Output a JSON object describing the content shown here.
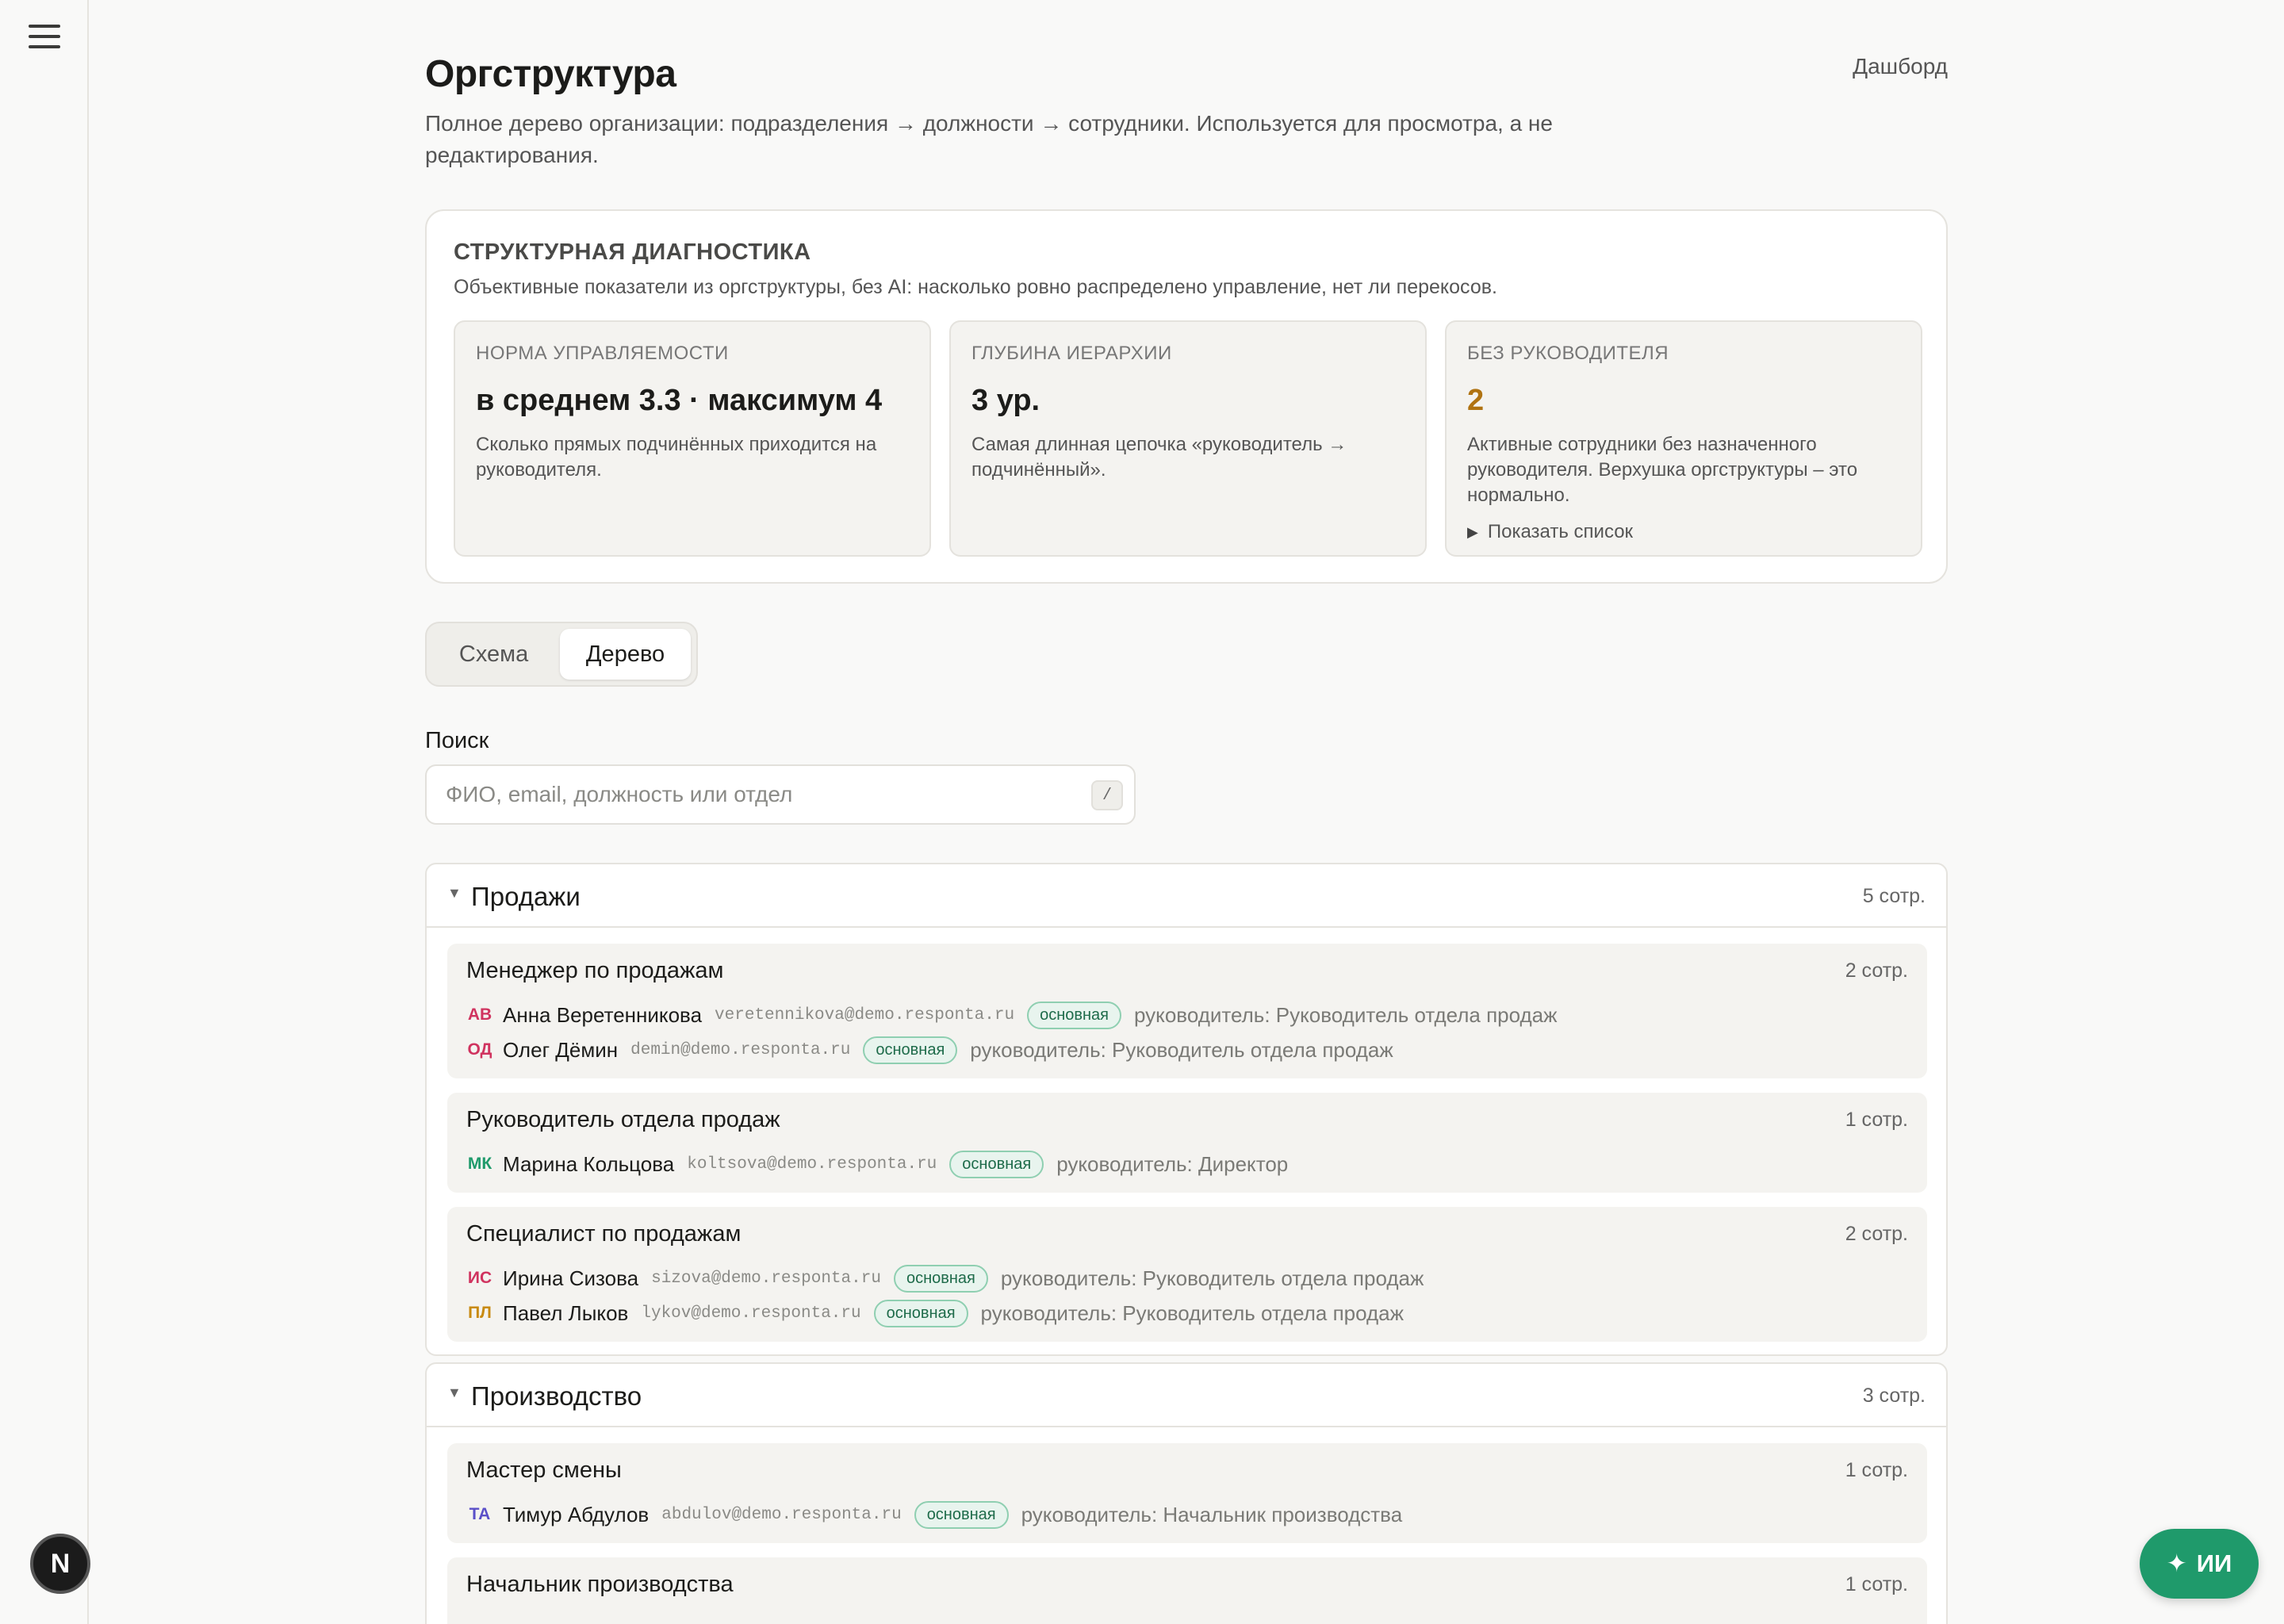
{
  "page": {
    "title": "Оргструктура",
    "dashboard_link": "Дашборд",
    "description": "Полное дерево организации: подразделения → должности → сотрудники. Используется для просмотра, а не редактирования."
  },
  "diagnostics": {
    "title": "СТРУКТУРНАЯ ДИАГНОСТИКА",
    "subtitle": "Объективные показатели из оргструктуры, без AI: насколько ровно распределено управление, нет ли перекосов.",
    "metrics": [
      {
        "label": "НОРМА УПРАВЛЯЕМОСТИ",
        "value": "в среднем 3.3 · максимум 4",
        "desc": "Сколько прямых подчинённых приходится на руководителя."
      },
      {
        "label": "ГЛУБИНА ИЕРАРХИИ",
        "value": "3 ур.",
        "desc": "Самая длинная цепочка «руководитель → подчинённый»."
      },
      {
        "label": "БЕЗ РУКОВОДИТЕЛЯ",
        "value": "2",
        "desc": "Активные сотрудники без назначенного руководителя. Верхушка оргструктуры – это нормально.",
        "toggle": "Показать список"
      }
    ],
    "warn_color": "#b07312"
  },
  "view_toggle": {
    "schema": "Схема",
    "tree": "Дерево",
    "active": "tree"
  },
  "search": {
    "label": "Поиск",
    "placeholder": "ФИО, email, должность или отдел",
    "value": "",
    "shortcut": "/"
  },
  "departments": [
    {
      "name": "Продажи",
      "count": "5 сотр.",
      "positions": [
        {
          "title": "Менеджер по продажам",
          "count": "2 сотр.",
          "employees": [
            {
              "initials": "АВ",
              "color": "#d0335f",
              "name": "Анна Веретенникова",
              "email": "veretennikova@demo.responta.ru",
              "badge": "основная",
              "manager": "руководитель: Руководитель отдела продаж"
            },
            {
              "initials": "ОД",
              "color": "#d0335f",
              "name": "Олег Дёмин",
              "email": "demin@demo.responta.ru",
              "badge": "основная",
              "manager": "руководитель: Руководитель отдела продаж"
            }
          ]
        },
        {
          "title": "Руководитель отдела продаж",
          "count": "1 сотр.",
          "employees": [
            {
              "initials": "МК",
              "color": "#1f9a6b",
              "name": "Марина Кольцова",
              "email": "koltsova@demo.responta.ru",
              "badge": "основная",
              "manager": "руководитель: Директор"
            }
          ]
        },
        {
          "title": "Специалист по продажам",
          "count": "2 сотр.",
          "employees": [
            {
              "initials": "ИС",
              "color": "#d0335f",
              "name": "Ирина Сизова",
              "email": "sizova@demo.responta.ru",
              "badge": "основная",
              "manager": "руководитель: Руководитель отдела продаж"
            },
            {
              "initials": "ПЛ",
              "color": "#c88a10",
              "name": "Павел Лыков",
              "email": "lykov@demo.responta.ru",
              "badge": "основная",
              "manager": "руководитель: Руководитель отдела продаж"
            }
          ]
        }
      ]
    },
    {
      "name": "Производство",
      "count": "3 сотр.",
      "positions": [
        {
          "title": "Мастер смены",
          "count": "1 сотр.",
          "employees": [
            {
              "initials": "ТА",
              "color": "#5a4fc8",
              "name": "Тимур Абдулов",
              "email": "abdulov@demo.responta.ru",
              "badge": "основная",
              "manager": "руководитель: Начальник производства"
            }
          ]
        },
        {
          "title": "Начальник производства",
          "count": "1 сотр.",
          "employees": []
        }
      ]
    }
  ],
  "ai_button": {
    "icon": "sparkle-icon",
    "label": "ИИ"
  },
  "corner_badge": {
    "letter": "N"
  }
}
